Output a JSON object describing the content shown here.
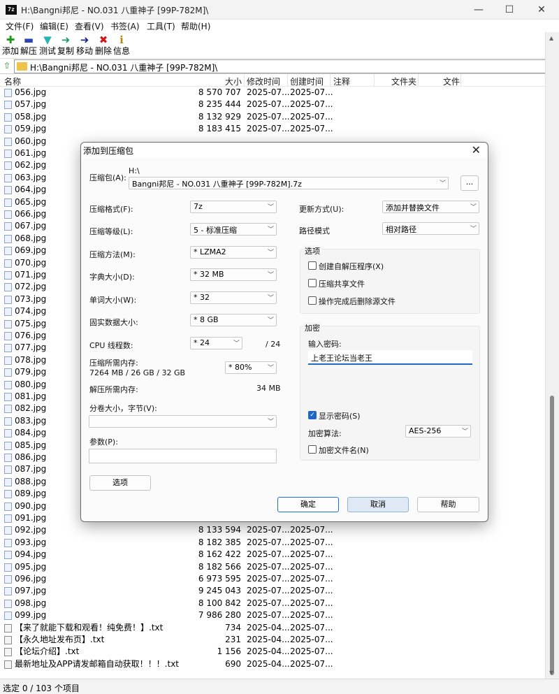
{
  "window": {
    "title": "H:\\Bangni邦尼 - NO.031 八重神子 [99P-782M]\\",
    "app_icon": "7z",
    "controls": {
      "minimize": "—",
      "maximize": "☐",
      "close": "✕"
    }
  },
  "menu": [
    "文件(F)",
    "编辑(E)",
    "查看(V)",
    "书签(A)",
    "工具(T)",
    "帮助(H)"
  ],
  "toolbar": [
    {
      "label": "添加",
      "icon": "add-icon",
      "color": "#1a9a1a"
    },
    {
      "label": "解压",
      "icon": "extract-icon",
      "color": "#2a44b8"
    },
    {
      "label": "测试",
      "icon": "test-icon",
      "color": "#2bb2b2"
    },
    {
      "label": "复制",
      "icon": "copy-icon",
      "color": "#1d9a6a"
    },
    {
      "label": "移动",
      "icon": "move-icon",
      "color": "#1a2a8a"
    },
    {
      "label": "删除",
      "icon": "delete-icon",
      "color": "#d01818"
    },
    {
      "label": "信息",
      "icon": "info-icon",
      "color": "#b08a10"
    }
  ],
  "address": "H:\\Bangni邦尼 - NO.031 八重神子 [99P-782M]\\",
  "columns": [
    "名称",
    "大小",
    "修改时间",
    "创建时间",
    "注释",
    "文件夹",
    "文件"
  ],
  "files": [
    {
      "name": "056.jpg",
      "size": "8 570 707",
      "modified": "2025-07...",
      "created": "2025-07..."
    },
    {
      "name": "057.jpg",
      "size": "8 235 444",
      "modified": "2025-07...",
      "created": "2025-07..."
    },
    {
      "name": "058.jpg",
      "size": "8 132 929",
      "modified": "2025-07...",
      "created": "2025-07..."
    },
    {
      "name": "059.jpg",
      "size": "8 183 415",
      "modified": "2025-07...",
      "created": "2025-07..."
    },
    {
      "name": "060.jpg",
      "size": "",
      "modified": "",
      "created": ""
    },
    {
      "name": "061.jpg",
      "size": "",
      "modified": "",
      "created": ""
    },
    {
      "name": "062.jpg",
      "size": "",
      "modified": "",
      "created": ""
    },
    {
      "name": "063.jpg",
      "size": "",
      "modified": "",
      "created": ""
    },
    {
      "name": "064.jpg",
      "size": "",
      "modified": "",
      "created": ""
    },
    {
      "name": "065.jpg",
      "size": "",
      "modified": "",
      "created": ""
    },
    {
      "name": "066.jpg",
      "size": "",
      "modified": "",
      "created": ""
    },
    {
      "name": "067.jpg",
      "size": "",
      "modified": "",
      "created": ""
    },
    {
      "name": "068.jpg",
      "size": "",
      "modified": "",
      "created": ""
    },
    {
      "name": "069.jpg",
      "size": "",
      "modified": "",
      "created": ""
    },
    {
      "name": "070.jpg",
      "size": "",
      "modified": "",
      "created": ""
    },
    {
      "name": "071.jpg",
      "size": "",
      "modified": "",
      "created": ""
    },
    {
      "name": "072.jpg",
      "size": "",
      "modified": "",
      "created": ""
    },
    {
      "name": "073.jpg",
      "size": "",
      "modified": "",
      "created": ""
    },
    {
      "name": "074.jpg",
      "size": "",
      "modified": "",
      "created": ""
    },
    {
      "name": "075.jpg",
      "size": "",
      "modified": "",
      "created": ""
    },
    {
      "name": "076.jpg",
      "size": "",
      "modified": "",
      "created": ""
    },
    {
      "name": "077.jpg",
      "size": "",
      "modified": "",
      "created": ""
    },
    {
      "name": "078.jpg",
      "size": "",
      "modified": "",
      "created": ""
    },
    {
      "name": "079.jpg",
      "size": "",
      "modified": "",
      "created": ""
    },
    {
      "name": "080.jpg",
      "size": "",
      "modified": "",
      "created": ""
    },
    {
      "name": "081.jpg",
      "size": "",
      "modified": "",
      "created": ""
    },
    {
      "name": "082.jpg",
      "size": "",
      "modified": "",
      "created": ""
    },
    {
      "name": "083.jpg",
      "size": "",
      "modified": "",
      "created": ""
    },
    {
      "name": "084.jpg",
      "size": "",
      "modified": "",
      "created": ""
    },
    {
      "name": "085.jpg",
      "size": "",
      "modified": "",
      "created": ""
    },
    {
      "name": "086.jpg",
      "size": "",
      "modified": "",
      "created": ""
    },
    {
      "name": "087.jpg",
      "size": "",
      "modified": "",
      "created": ""
    },
    {
      "name": "088.jpg",
      "size": "",
      "modified": "",
      "created": ""
    },
    {
      "name": "089.jpg",
      "size": "",
      "modified": "",
      "created": ""
    },
    {
      "name": "090.jpg",
      "size": "",
      "modified": "",
      "created": ""
    },
    {
      "name": "091.jpg",
      "size": "",
      "modified": "",
      "created": ""
    },
    {
      "name": "092.jpg",
      "size": "8 133 594",
      "modified": "2025-07...",
      "created": "2025-07..."
    },
    {
      "name": "093.jpg",
      "size": "8 182 385",
      "modified": "2025-07...",
      "created": "2025-07..."
    },
    {
      "name": "094.jpg",
      "size": "8 162 422",
      "modified": "2025-07...",
      "created": "2025-07..."
    },
    {
      "name": "095.jpg",
      "size": "8 182 566",
      "modified": "2025-07...",
      "created": "2025-07..."
    },
    {
      "name": "096.jpg",
      "size": "6 973 595",
      "modified": "2025-07...",
      "created": "2025-07..."
    },
    {
      "name": "097.jpg",
      "size": "9 245 043",
      "modified": "2025-07...",
      "created": "2025-07..."
    },
    {
      "name": "098.jpg",
      "size": "8 100 842",
      "modified": "2025-07...",
      "created": "2025-07..."
    },
    {
      "name": "099.jpg",
      "size": "7 986 280",
      "modified": "2025-07...",
      "created": "2025-07..."
    },
    {
      "name": "【来了就能下载和观看！纯免费！】.txt",
      "size": "734",
      "modified": "2025-04...",
      "created": "2025-07...",
      "type": "txt"
    },
    {
      "name": "【永久地址发布页】.txt",
      "size": "231",
      "modified": "2025-04...",
      "created": "2025-07...",
      "type": "txt"
    },
    {
      "name": "【论坛介绍】.txt",
      "size": "1 156",
      "modified": "2025-04...",
      "created": "2025-07...",
      "type": "txt"
    },
    {
      "name": "最新地址及APP请发邮箱自动获取！！！.txt",
      "size": "690",
      "modified": "2025-04...",
      "created": "2025-07...",
      "type": "txt"
    }
  ],
  "status": "选定 0 / 103 个项目",
  "dialog": {
    "title": "添加到压缩包",
    "archive_label": "压缩包(A):",
    "archive_dir": "H:\\",
    "archive_name": "Bangni邦尼 - NO.031 八重神子 [99P-782M].7z",
    "browse": "...",
    "format_label": "压缩格式(F):",
    "format_value": "7z",
    "level_label": "压缩等级(L):",
    "level_value": "5 - 标准压缩",
    "method_label": "压缩方法(M):",
    "method_value": "* LZMA2",
    "dict_label": "字典大小(D):",
    "dict_value": "* 32 MB",
    "word_label": "单词大小(W):",
    "word_value": "* 32",
    "solid_label": "固实数据大小:",
    "solid_value": "* 8 GB",
    "cpu_label": "CPU 线程数:",
    "cpu_value": "* 24",
    "cpu_total": "/ 24",
    "mem_label": "压缩所需内存:",
    "mem_detail": "7264 MB / 26 GB / 32 GB",
    "mem_value": "* 80%",
    "decomp_label": "解压所需内存:",
    "decomp_value": "34 MB",
    "split_label": "分卷大小，字节(V):",
    "params_label": "参数(P):",
    "options_button": "选项",
    "update_label": "更新方式(U):",
    "update_value": "添加并替换文件",
    "path_label": "路径模式",
    "path_value": "相对路径",
    "options_group": "选项",
    "opt_sfx": "创建自解压程序(X)",
    "opt_shared": "压缩共享文件",
    "opt_delete": "操作完成后删除源文件",
    "encrypt_group": "加密",
    "password_label": "输入密码:",
    "password_value": "上老王论坛当老王",
    "show_password": "显示密码(S)",
    "enc_method_label": "加密算法:",
    "enc_method_value": "AES-256",
    "enc_names": "加密文件名(N)",
    "ok": "确定",
    "cancel": "取消",
    "help": "帮助",
    "close": "✕"
  }
}
